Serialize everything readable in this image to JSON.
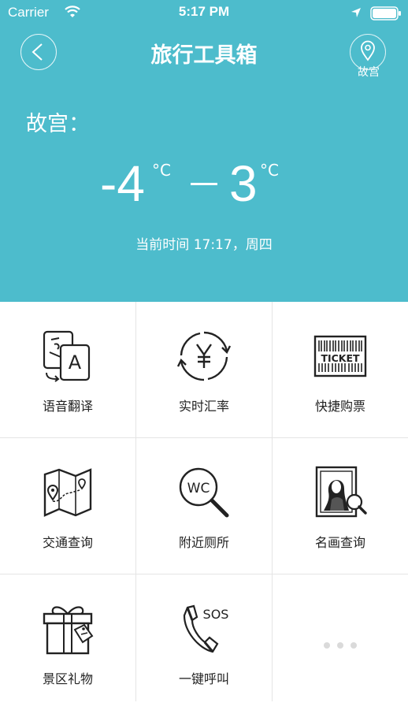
{
  "status_bar": {
    "carrier": "Carrier",
    "time": "5:17 PM"
  },
  "header": {
    "title": "旅行工具箱",
    "location_label": "故宫",
    "place": "故宫：",
    "temp_low": "-4",
    "temp_high": "3",
    "unit": "°C",
    "current_time": "当前时间 17:17，周四"
  },
  "tools": [
    {
      "label": "语音翻译",
      "icon": "translate-icon"
    },
    {
      "label": "实时汇率",
      "icon": "currency-exchange-icon"
    },
    {
      "label": "快捷购票",
      "icon": "ticket-icon"
    },
    {
      "label": "交通查询",
      "icon": "map-route-icon"
    },
    {
      "label": "附近厕所",
      "icon": "toilet-search-icon"
    },
    {
      "label": "名画查询",
      "icon": "painting-search-icon"
    },
    {
      "label": "景区礼物",
      "icon": "gift-icon"
    },
    {
      "label": "一键呼叫",
      "icon": "sos-phone-icon"
    }
  ],
  "icons": {
    "sos_text": "SOS",
    "ticket_text": "TICKET",
    "wc_text": "WC",
    "translate_text": "A"
  },
  "colors": {
    "header_bg": "#4dbccc",
    "grid_line": "#e4e4e4",
    "text": "#222222"
  }
}
